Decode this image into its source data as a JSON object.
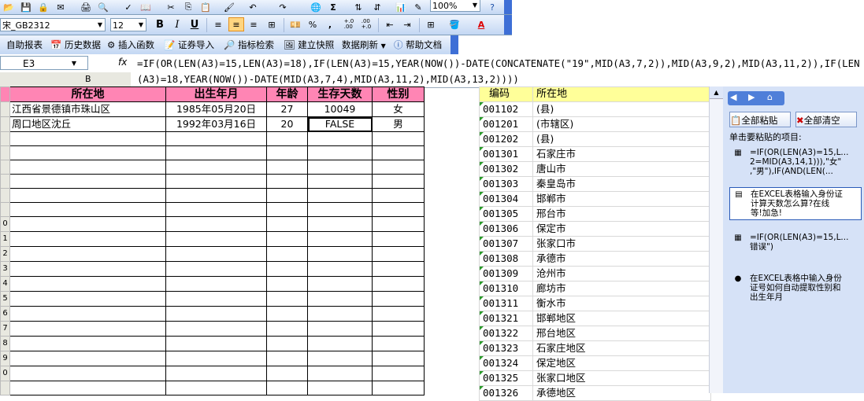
{
  "toolbar": {
    "zoom": "100%",
    "font_name": "宋_GB2312",
    "font_size": "12",
    "bold": "B",
    "italic": "I",
    "underline": "U",
    "percent": "%",
    "comma": ",",
    "inc_decimal": "+.0\n.00",
    "dec_decimal": ".00\n+.0",
    "sigma": "Σ",
    "font_color_letter": "A",
    "plugin_items": [
      "自助报表",
      "历史数据",
      "插入函数",
      "证券导入",
      "指标检索",
      "建立快照",
      "数据刷新",
      "帮助文档"
    ]
  },
  "formula_bar": {
    "name_box": "E3",
    "fx_label": "fx",
    "formula": "=IF(OR(LEN(A3)=15,LEN(A3)=18),IF(LEN(A3)=15,YEAR(NOW())-DATE(CONCATENATE(\"19\",MID(A3,7,2)),MID(A3,9,2),MID(A3,11,2)),IF(LEN(A3)=18,YEAR(NOW())-DATE(MID(A3,7,4),MID(A3,11,2),MID(A3,13,2))))"
  },
  "column_header": "B",
  "main_table": {
    "headers": [
      "所在地",
      "出生年月",
      "年龄",
      "生存天数",
      "性别"
    ],
    "rows": [
      [
        "江西省景德镇市珠山区",
        "1985年05月20日",
        "27",
        "10049",
        "女"
      ],
      [
        "周口地区沈丘",
        "1992年03月16日",
        "20",
        "FALSE",
        "男"
      ]
    ],
    "row_labels": [
      "",
      "",
      "",
      "",
      "",
      "",
      "",
      "",
      "",
      "0",
      "1",
      "2",
      "3",
      "4",
      "5",
      "6",
      "7",
      "8",
      "9",
      "0",
      ""
    ]
  },
  "right_table": {
    "headers": [
      "编码",
      "所在地"
    ],
    "rows": [
      [
        "001102",
        "(县)"
      ],
      [
        "001201",
        "(市辖区)"
      ],
      [
        "001202",
        "(县)"
      ],
      [
        "001301",
        "石家庄市"
      ],
      [
        "001302",
        "唐山市"
      ],
      [
        "001303",
        "秦皇岛市"
      ],
      [
        "001304",
        "邯郸市"
      ],
      [
        "001305",
        "邢台市"
      ],
      [
        "001306",
        "保定市"
      ],
      [
        "001307",
        "张家口市"
      ],
      [
        "001308",
        "承德市"
      ],
      [
        "001309",
        "沧州市"
      ],
      [
        "001310",
        "廊坊市"
      ],
      [
        "001311",
        "衡水市"
      ],
      [
        "001321",
        "邯郸地区"
      ],
      [
        "001322",
        "邢台地区"
      ],
      [
        "001323",
        "石家庄地区"
      ],
      [
        "001324",
        "保定地区"
      ],
      [
        "001325",
        "张家口地区"
      ],
      [
        "001326",
        "承德地区"
      ]
    ]
  },
  "clipboard_pane": {
    "paste_all": "全部粘贴",
    "clear_all": "全部清空",
    "prompt": "单击要粘贴的项目:",
    "items": [
      "=IF(OR(LEN(A3)=15,L...\n2=MID(A3,14,1))),\"女\"\n,\"男\"),IF(AND(LEN(...",
      "在EXCEL表格输入身份证\n计算天数怎么算?在线\n等!加急!",
      "=IF(OR(LEN(A3)=15,L...\n错误\")",
      "在EXCEL表格中输入身份\n证号如何自动提取性别和\n出生年月"
    ]
  }
}
